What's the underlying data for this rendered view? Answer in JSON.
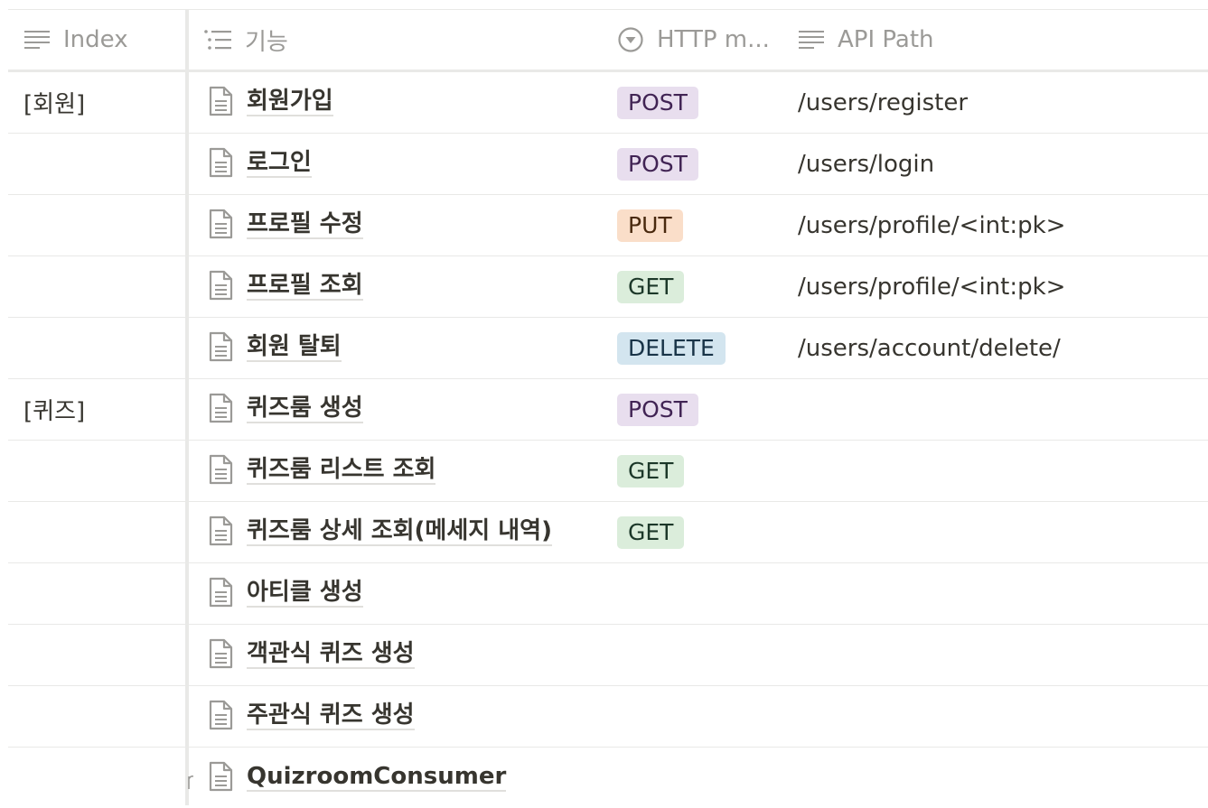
{
  "columns": {
    "index": "Index",
    "function": "기능",
    "method": "HTTP m...",
    "path": "API Path"
  },
  "method_colors": {
    "POST": {
      "bg": "#e8deee",
      "fg": "#412454"
    },
    "PUT": {
      "bg": "#fadec9",
      "fg": "#49290e"
    },
    "GET": {
      "bg": "#dbeddb",
      "fg": "#1c3829"
    },
    "DELETE": {
      "bg": "#d3e5ef",
      "fg": "#183347"
    }
  },
  "rows": [
    {
      "index": "[회원]",
      "title": "회원가입",
      "method": "POST",
      "path": "/users/register"
    },
    {
      "index": "",
      "title": "로그인",
      "method": "POST",
      "path": "/users/login"
    },
    {
      "index": "",
      "title": "프로필 수정",
      "method": "PUT",
      "path": "/users/profile/<int:pk>"
    },
    {
      "index": "",
      "title": "프로필 조회",
      "method": "GET",
      "path": "/users/profile/<int:pk>"
    },
    {
      "index": "",
      "title": "회원 탈퇴",
      "method": "DELETE",
      "path": "/users/account/delete/"
    },
    {
      "index": "[퀴즈]",
      "title": "퀴즈룸 생성",
      "method": "POST",
      "path": ""
    },
    {
      "index": "",
      "title": "퀴즈룸 리스트 조회",
      "method": "GET",
      "path": ""
    },
    {
      "index": "",
      "title": "퀴즈룸 상세 조회(메세지 내역)",
      "method": "GET",
      "path": ""
    },
    {
      "index": "",
      "title": "아티클 생성",
      "method": "",
      "path": ""
    },
    {
      "index": "",
      "title": "객관식 퀴즈 생성",
      "method": "",
      "path": ""
    },
    {
      "index": "",
      "title": "주관식 퀴즈 생성",
      "method": "",
      "path": ""
    },
    {
      "index": "",
      "title": "QuizroomConsumer",
      "method": "",
      "path": ""
    }
  ]
}
